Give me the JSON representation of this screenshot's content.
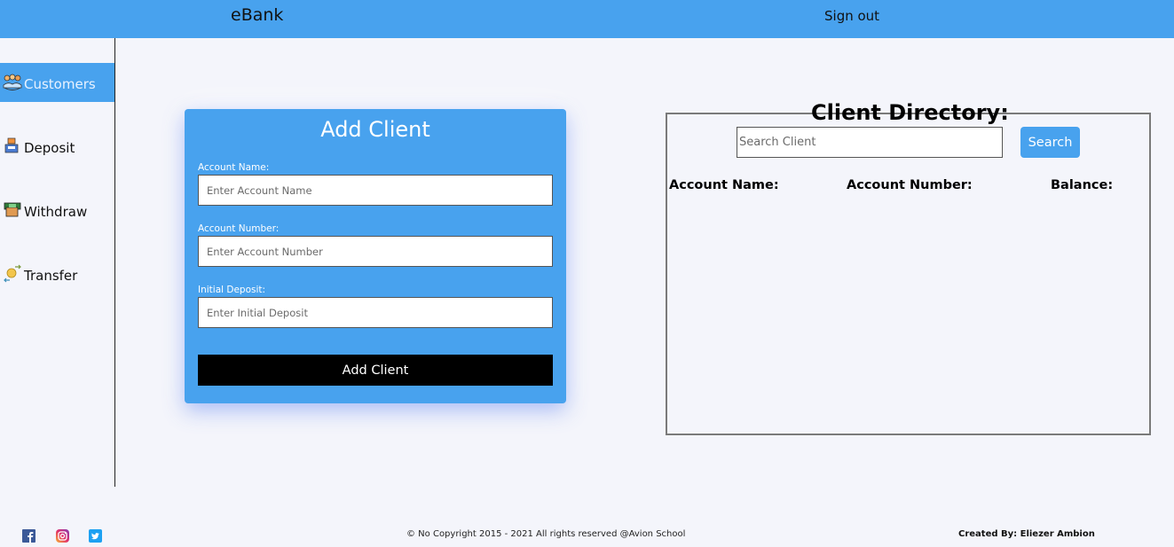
{
  "header": {
    "brand": "eBank",
    "sign_out": "Sign out"
  },
  "sidebar": {
    "items": [
      {
        "label": "Customers",
        "icon": "customers-icon",
        "active": true
      },
      {
        "label": "Deposit",
        "icon": "deposit-icon",
        "active": false
      },
      {
        "label": "Withdraw",
        "icon": "withdraw-icon",
        "active": false
      },
      {
        "label": "Transfer",
        "icon": "transfer-icon",
        "active": false
      }
    ]
  },
  "add_client": {
    "title": "Add Client",
    "fields": [
      {
        "label": "Account Name:",
        "placeholder": "Enter Account Name",
        "value": ""
      },
      {
        "label": "Account Number:",
        "placeholder": "Enter Account Number",
        "value": ""
      },
      {
        "label": "Initial Deposit:",
        "placeholder": "Enter Initial Deposit",
        "value": ""
      }
    ],
    "submit_label": "Add Client"
  },
  "directory": {
    "title": "Client Directory:",
    "search_placeholder": "Search Client",
    "search_value": "",
    "search_button": "Search",
    "columns": [
      "Account Name:",
      "Account Number:",
      "Balance:"
    ],
    "rows": []
  },
  "footer": {
    "social": [
      "facebook-icon",
      "instagram-icon",
      "twitter-icon"
    ],
    "copyright": "© No Copyright 2015 - 2021 All rights reserved @Avion School",
    "created_by": "Created By: Eliezer Ambion"
  },
  "colors": {
    "accent": "#48a2ee",
    "background": "#f4f5fb",
    "button_dark": "#000000"
  }
}
